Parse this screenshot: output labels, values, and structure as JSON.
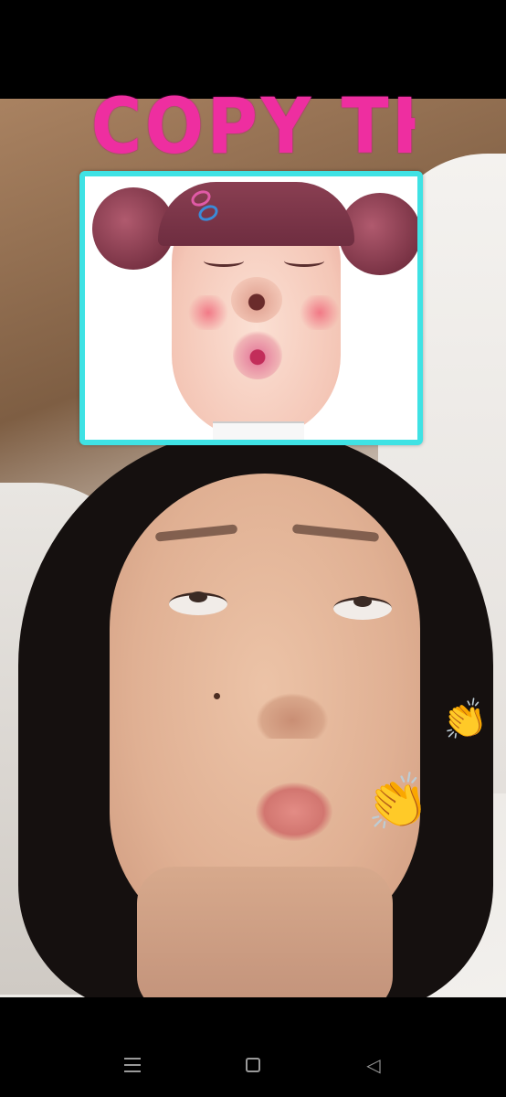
{
  "overlay": {
    "title": "COPY THE FACE",
    "frame_color": "#3fe2e4",
    "title_color": "#ee2ea0",
    "stickers": [
      "clapping-hands",
      "clapping-hands"
    ]
  },
  "nav_bar": {
    "buttons": [
      "menu-icon",
      "home-icon",
      "back-icon"
    ]
  }
}
